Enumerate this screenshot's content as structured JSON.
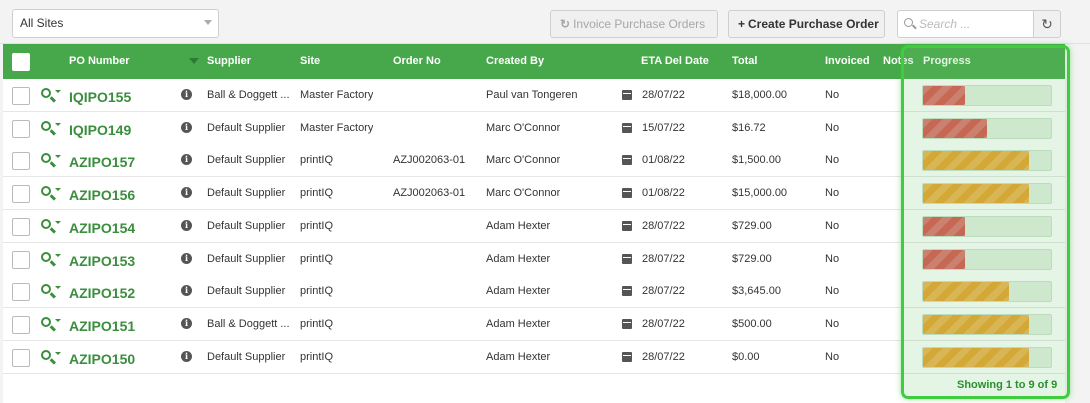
{
  "toolbar": {
    "site_select": "All Sites",
    "invoice_button": "Invoice Purchase Orders",
    "create_button": "Create Purchase Order",
    "search_placeholder": "Search ..."
  },
  "columns": {
    "po_number": "PO Number",
    "supplier": "Supplier",
    "site": "Site",
    "order_no": "Order No",
    "created_by": "Created By",
    "eta": "ETA Del Date",
    "total": "Total",
    "invoiced": "Invoiced",
    "notes": "Notes",
    "progress": "Progress"
  },
  "colors": {
    "header": "#46a84a",
    "po_link": "#3a8e3e",
    "progress_red": "#d9534f",
    "progress_orange": "#eba12a",
    "highlight": "#3fcc3f"
  },
  "rows": [
    {
      "po": "IQIPO155",
      "supplier": "Ball & Doggett ...",
      "site": "Master Factory",
      "order_no": "",
      "created_by": "Paul van Tongeren",
      "eta": "28/07/22",
      "total": "$18,000.00",
      "invoiced": "No",
      "progress": 0.33,
      "status": "red"
    },
    {
      "po": "IQIPO149",
      "supplier": "Default Supplier",
      "site": "Master Factory",
      "order_no": "",
      "created_by": "Marc O'Connor",
      "eta": "15/07/22",
      "total": "$16.72",
      "invoiced": "No",
      "progress": 0.5,
      "status": "red"
    },
    {
      "po": "AZIPO157",
      "supplier": "Default Supplier",
      "site": "printIQ",
      "order_no": "AZJ002063-01",
      "created_by": "Marc O'Connor",
      "eta": "01/08/22",
      "total": "$1,500.00",
      "invoiced": "No",
      "progress": 0.83,
      "status": "orange"
    },
    {
      "po": "AZIPO156",
      "supplier": "Default Supplier",
      "site": "printIQ",
      "order_no": "AZJ002063-01",
      "created_by": "Marc O'Connor",
      "eta": "01/08/22",
      "total": "$15,000.00",
      "invoiced": "No",
      "progress": 0.83,
      "status": "orange"
    },
    {
      "po": "AZIPO154",
      "supplier": "Default Supplier",
      "site": "printIQ",
      "order_no": "",
      "created_by": "Adam Hexter",
      "eta": "28/07/22",
      "total": "$729.00",
      "invoiced": "No",
      "progress": 0.33,
      "status": "red"
    },
    {
      "po": "AZIPO153",
      "supplier": "Default Supplier",
      "site": "printIQ",
      "order_no": "",
      "created_by": "Adam Hexter",
      "eta": "28/07/22",
      "total": "$729.00",
      "invoiced": "No",
      "progress": 0.33,
      "status": "red"
    },
    {
      "po": "AZIPO152",
      "supplier": "Default Supplier",
      "site": "printIQ",
      "order_no": "",
      "created_by": "Adam Hexter",
      "eta": "28/07/22",
      "total": "$3,645.00",
      "invoiced": "No",
      "progress": 0.67,
      "status": "orange"
    },
    {
      "po": "AZIPO151",
      "supplier": "Ball & Doggett ...",
      "site": "printIQ",
      "order_no": "",
      "created_by": "Adam Hexter",
      "eta": "28/07/22",
      "total": "$500.00",
      "invoiced": "No",
      "progress": 0.83,
      "status": "orange"
    },
    {
      "po": "AZIPO150",
      "supplier": "Default Supplier",
      "site": "printIQ",
      "order_no": "",
      "created_by": "Adam Hexter",
      "eta": "28/07/22",
      "total": "$0.00",
      "invoiced": "No",
      "progress": 0.83,
      "status": "orange"
    }
  ],
  "footer": {
    "showing": "Showing 1 to 9 of 9"
  }
}
